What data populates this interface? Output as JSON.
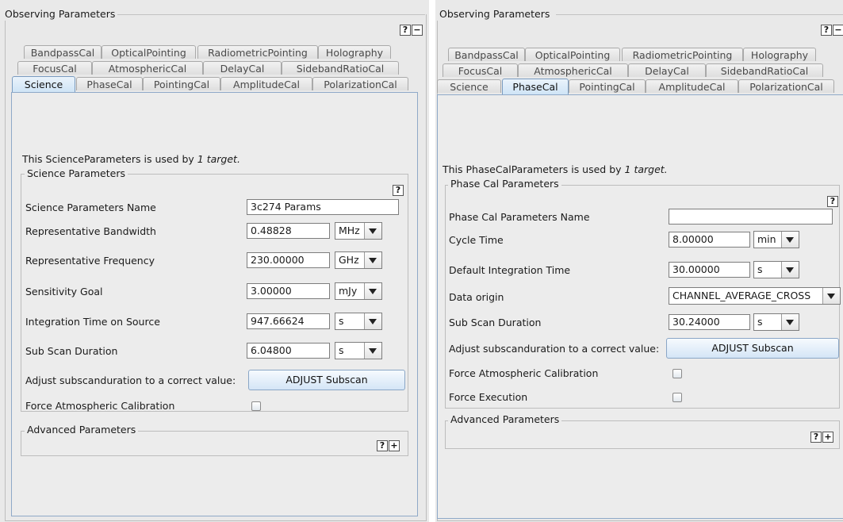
{
  "left": {
    "header": "Observing Parameters",
    "help_label": "?",
    "collapse_label": "−",
    "tabs_row1": [
      "BandpassCal",
      "OpticalPointing",
      "RadiometricPointing",
      "Holography"
    ],
    "tabs_row2": [
      "FocusCal",
      "AtmosphericCal",
      "DelayCal",
      "SidebandRatioCal"
    ],
    "tabs_row3": [
      "Science",
      "PhaseCal",
      "PointingCal",
      "AmplitudeCal",
      "PolarizationCal"
    ],
    "selected_tab": "Science",
    "usage_prefix": "This ScienceParameters is used by ",
    "usage_count": "1 target.",
    "section_title": "Science Parameters",
    "fields": {
      "name_label": "Science Parameters Name",
      "name_value": "3c274 Params",
      "bw_label": "Representative Bandwidth",
      "bw_value": "0.48828",
      "bw_unit": "MHz",
      "freq_label": "Representative Frequency",
      "freq_value": "230.00000",
      "freq_unit": "GHz",
      "sens_label": "Sensitivity Goal",
      "sens_value": "3.00000",
      "sens_unit": "mJy",
      "int_label": "Integration Time on Source",
      "int_value": "947.66624",
      "int_unit": "s",
      "sub_label": "Sub Scan Duration",
      "sub_value": "6.04800",
      "sub_unit": "s",
      "adjust_label": "Adjust subscanduration to a correct value:",
      "adjust_button": "ADJUST Subscan",
      "force_atm_label": "Force Atmospheric Calibration",
      "force_atm_checked": false
    },
    "advanced_title": "Advanced Parameters",
    "advanced_expand_label": "+"
  },
  "right": {
    "header": "Observing Parameters",
    "help_label": "?",
    "collapse_label": "−",
    "tabs_row1": [
      "BandpassCal",
      "OpticalPointing",
      "RadiometricPointing",
      "Holography"
    ],
    "tabs_row2": [
      "FocusCal",
      "AtmosphericCal",
      "DelayCal",
      "SidebandRatioCal"
    ],
    "tabs_row3": [
      "Science",
      "PhaseCal",
      "PointingCal",
      "AmplitudeCal",
      "PolarizationCal"
    ],
    "selected_tab": "PhaseCal",
    "usage_prefix": "This PhaseCalParameters is used by ",
    "usage_count": "1 target.",
    "section_title": "Phase Cal Parameters",
    "fields": {
      "name_label": "Phase Cal Parameters Name",
      "name_value": "",
      "cycle_label": "Cycle Time",
      "cycle_value": "8.00000",
      "cycle_unit": "min",
      "dint_label": "Default Integration Time",
      "dint_value": "30.00000",
      "dint_unit": "s",
      "origin_label": "Data origin",
      "origin_value": "CHANNEL_AVERAGE_CROSS",
      "sub_label": "Sub Scan Duration",
      "sub_value": "30.24000",
      "sub_unit": "s",
      "adjust_label": "Adjust subscanduration to a correct value:",
      "adjust_button": "ADJUST Subscan",
      "force_atm_label": "Force Atmospheric Calibration",
      "force_atm_checked": false,
      "force_exec_label": "Force Execution",
      "force_exec_checked": false
    },
    "advanced_title": "Advanced Parameters",
    "advanced_expand_label": "+"
  }
}
